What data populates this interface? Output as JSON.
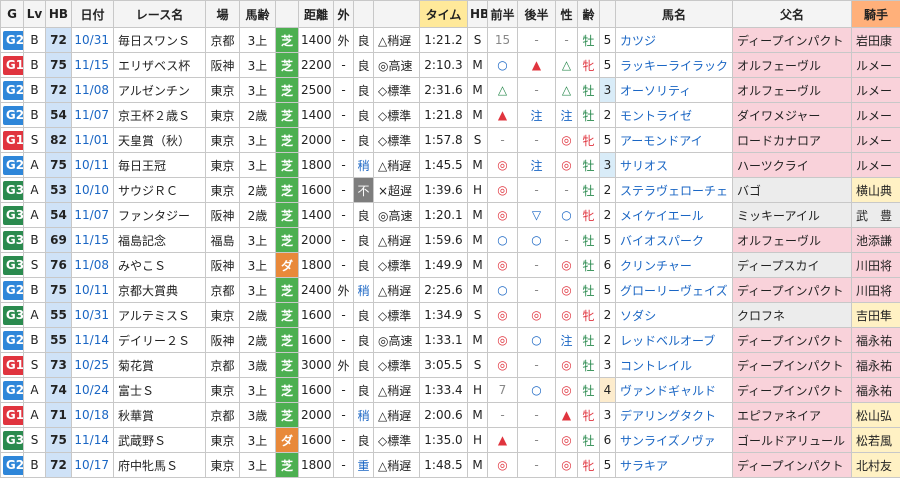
{
  "headers": {
    "g": "G",
    "lv": "Lv",
    "hb": "HB",
    "date": "日付",
    "race": "レース名",
    "venue": "場",
    "age": "馬齢",
    "surf": "芝",
    "dist": "距離",
    "rail": "外",
    "cond": "",
    "pace": "",
    "time": "タイム",
    "hbcls": "HB",
    "first": "前半",
    "second": "後半",
    "sex": "性",
    "horse_age": "齢",
    "horse": "馬名",
    "sire": "父名",
    "jockey": "騎手",
    "dist_label": "距離",
    "hb2": "HB",
    "first_label": "前半",
    "second_label": "後半",
    "sex_label": "性",
    "age_label": "齢",
    "horse_label": "馬名",
    "sire_label": "父名",
    "jockey_label": "騎手",
    "race_label": "レース名",
    "venue_label": "場",
    "age_race_label": "馬齢",
    "date_label": "日付",
    "time_label": "タイム",
    "outer_label": "外"
  },
  "rows": [
    {
      "g": "G2",
      "lv": "B",
      "hb": "72",
      "date": "10/31",
      "race": "毎日スワンＳ",
      "venue": "京都",
      "age": "3上",
      "surf": "芝",
      "dist": "1400",
      "rail": "外",
      "cond": "良",
      "pace": "△稍遅",
      "time": "1:21.2",
      "cls": "S",
      "first": "15",
      "second": "-",
      "f1": "-",
      "sex": "牡",
      "hage": "5",
      "horse": "カツジ",
      "sire": "ディープインパクト",
      "jockey": "岩田康"
    },
    {
      "g": "G1",
      "lv": "B",
      "hb": "75",
      "date": "11/15",
      "race": "エリザベス杯",
      "venue": "阪神",
      "age": "3上",
      "surf": "芝",
      "dist": "2200",
      "rail": "-",
      "cond": "良",
      "pace": "◎高速",
      "time": "2:10.3",
      "cls": "M",
      "first": "○",
      "second": "▲",
      "f1": "△",
      "sex": "牝",
      "hage": "5",
      "horse": "ラッキーライラック",
      "sire": "オルフェーヴル",
      "jockey": "ルメー"
    },
    {
      "g": "G2",
      "lv": "B",
      "hb": "72",
      "date": "11/08",
      "race": "アルゼンチン",
      "venue": "東京",
      "age": "3上",
      "surf": "芝",
      "dist": "2500",
      "rail": "-",
      "cond": "良",
      "pace": "◇標準",
      "time": "2:31.6",
      "cls": "M",
      "first": "△",
      "second": "-",
      "f1": "△",
      "sex": "牡",
      "hage": "3",
      "horse": "オーソリティ",
      "sire": "オルフェーヴル",
      "jockey": "ルメー"
    },
    {
      "g": "G2",
      "lv": "B",
      "hb": "54",
      "date": "11/07",
      "race": "京王杯２歳Ｓ",
      "venue": "東京",
      "age": "2歳",
      "surf": "芝",
      "dist": "1400",
      "rail": "-",
      "cond": "良",
      "pace": "◇標準",
      "time": "1:21.8",
      "cls": "M",
      "first": "▲",
      "second": "注",
      "f1": "注",
      "sex": "牡",
      "hage": "2",
      "horse": "モントライゼ",
      "sire": "ダイワメジャー",
      "jockey": "ルメー"
    },
    {
      "g": "G1",
      "lv": "S",
      "hb": "82",
      "date": "11/01",
      "race": "天皇賞（秋）",
      "venue": "東京",
      "age": "3上",
      "surf": "芝",
      "dist": "2000",
      "rail": "-",
      "cond": "良",
      "pace": "◇標準",
      "time": "1:57.8",
      "cls": "S",
      "first": "-",
      "second": "-",
      "f1": "◎",
      "sex": "牝",
      "hage": "5",
      "horse": "アーモンドアイ",
      "sire": "ロードカナロア",
      "jockey": "ルメー"
    },
    {
      "g": "G2",
      "lv": "A",
      "hb": "75",
      "date": "10/11",
      "race": "毎日王冠",
      "venue": "東京",
      "age": "3上",
      "surf": "芝",
      "dist": "1800",
      "rail": "-",
      "cond": "稍",
      "pace": "△稍遅",
      "time": "1:45.5",
      "cls": "M",
      "first": "◎",
      "second": "注",
      "f1": "◎",
      "sex": "牡",
      "hage": "3",
      "horse": "サリオス",
      "sire": "ハーツクライ",
      "jockey": "ルメー"
    },
    {
      "g": "G3",
      "lv": "A",
      "hb": "53",
      "date": "10/10",
      "race": "サウジＲＣ",
      "venue": "東京",
      "age": "2歳",
      "surf": "芝",
      "dist": "1600",
      "rail": "-",
      "cond": "不",
      "pace": "×超遅",
      "time": "1:39.6",
      "cls": "H",
      "first": "◎",
      "second": "-",
      "f1": "-",
      "sex": "牡",
      "hage": "2",
      "horse": "ステラヴェローチェ",
      "sire": "バゴ",
      "jockey": "横山典"
    },
    {
      "g": "G3",
      "lv": "A",
      "hb": "54",
      "date": "11/07",
      "race": "ファンタジー",
      "venue": "阪神",
      "age": "2歳",
      "surf": "芝",
      "dist": "1400",
      "rail": "-",
      "cond": "良",
      "pace": "◎高速",
      "time": "1:20.1",
      "cls": "M",
      "first": "◎",
      "second": "▽",
      "f1": "○",
      "sex": "牝",
      "hage": "2",
      "horse": "メイケイエール",
      "sire": "ミッキーアイル",
      "jockey": "武　豊"
    },
    {
      "g": "G3",
      "lv": "B",
      "hb": "69",
      "date": "11/15",
      "race": "福島記念",
      "venue": "福島",
      "age": "3上",
      "surf": "芝",
      "dist": "2000",
      "rail": "-",
      "cond": "良",
      "pace": "△稍遅",
      "time": "1:59.6",
      "cls": "M",
      "first": "○",
      "second": "○",
      "f1": "-",
      "sex": "牡",
      "hage": "5",
      "horse": "バイオスパーク",
      "sire": "オルフェーヴル",
      "jockey": "池添謙"
    },
    {
      "g": "G3",
      "lv": "S",
      "hb": "76",
      "date": "11/08",
      "race": "みやこＳ",
      "venue": "阪神",
      "age": "3上",
      "surf": "ダ",
      "dist": "1800",
      "rail": "-",
      "cond": "良",
      "pace": "◇標準",
      "time": "1:49.9",
      "cls": "M",
      "first": "◎",
      "second": "-",
      "f1": "◎",
      "sex": "牡",
      "hage": "6",
      "horse": "クリンチャー",
      "sire": "ディープスカイ",
      "jockey": "川田将"
    },
    {
      "g": "G2",
      "lv": "B",
      "hb": "75",
      "date": "10/11",
      "race": "京都大賞典",
      "venue": "京都",
      "age": "3上",
      "surf": "芝",
      "dist": "2400",
      "rail": "外",
      "cond": "稍",
      "pace": "△稍遅",
      "time": "2:25.6",
      "cls": "M",
      "first": "○",
      "second": "-",
      "f1": "◎",
      "sex": "牡",
      "hage": "5",
      "horse": "グローリーヴェイズ",
      "sire": "ディープインパクト",
      "jockey": "川田将"
    },
    {
      "g": "G3",
      "lv": "A",
      "hb": "55",
      "date": "10/31",
      "race": "アルテミスＳ",
      "venue": "東京",
      "age": "2歳",
      "surf": "芝",
      "dist": "1600",
      "rail": "-",
      "cond": "良",
      "pace": "◇標準",
      "time": "1:34.9",
      "cls": "S",
      "first": "◎",
      "second": "◎",
      "f1": "◎",
      "sex": "牝",
      "hage": "2",
      "horse": "ソダシ",
      "sire": "クロフネ",
      "jockey": "吉田隼"
    },
    {
      "g": "G2",
      "lv": "B",
      "hb": "55",
      "date": "11/14",
      "race": "デイリー２Ｓ",
      "venue": "阪神",
      "age": "2歳",
      "surf": "芝",
      "dist": "1600",
      "rail": "-",
      "cond": "良",
      "pace": "◎高速",
      "time": "1:33.1",
      "cls": "M",
      "first": "◎",
      "second": "○",
      "f1": "注",
      "sex": "牡",
      "hage": "2",
      "horse": "レッドベルオーブ",
      "sire": "ディープインパクト",
      "jockey": "福永祐"
    },
    {
      "g": "G1",
      "lv": "S",
      "hb": "73",
      "date": "10/25",
      "race": "菊花賞",
      "venue": "京都",
      "age": "3歳",
      "surf": "芝",
      "dist": "3000",
      "rail": "外",
      "cond": "良",
      "pace": "◇標準",
      "time": "3:05.5",
      "cls": "S",
      "first": "◎",
      "second": "-",
      "f1": "◎",
      "sex": "牡",
      "hage": "3",
      "horse": "コントレイル",
      "sire": "ディープインパクト",
      "jockey": "福永祐"
    },
    {
      "g": "G2",
      "lv": "A",
      "hb": "74",
      "date": "10/24",
      "race": "富士Ｓ",
      "venue": "東京",
      "age": "3上",
      "surf": "芝",
      "dist": "1600",
      "rail": "-",
      "cond": "良",
      "pace": "△稍遅",
      "time": "1:33.4",
      "cls": "H",
      "first": "7",
      "second": "○",
      "f1": "◎",
      "sex": "牡",
      "hage": "4",
      "horse": "ヴァンドギャルド",
      "sire": "ディープインパクト",
      "jockey": "福永祐"
    },
    {
      "g": "G1",
      "lv": "A",
      "hb": "71",
      "date": "10/18",
      "race": "秋華賞",
      "venue": "京都",
      "age": "3歳",
      "surf": "芝",
      "dist": "2000",
      "rail": "-",
      "cond": "稍",
      "pace": "△稍遅",
      "time": "2:00.6",
      "cls": "M",
      "first": "-",
      "second": "-",
      "f1": "▲",
      "sex": "牝",
      "hage": "3",
      "horse": "デアリングタクト",
      "sire": "エピファネイア",
      "jockey": "松山弘"
    },
    {
      "g": "G3",
      "lv": "S",
      "hb": "75",
      "date": "11/14",
      "race": "武蔵野Ｓ",
      "venue": "東京",
      "age": "3上",
      "surf": "ダ",
      "dist": "1600",
      "rail": "-",
      "cond": "良",
      "pace": "◇標準",
      "time": "1:35.0",
      "cls": "H",
      "first": "▲",
      "second": "-",
      "f1": "◎",
      "sex": "牡",
      "hage": "6",
      "horse": "サンライズノヴァ",
      "sire": "ゴールドアリュール",
      "jockey": "松若風"
    },
    {
      "g": "G2",
      "lv": "B",
      "hb": "72",
      "date": "10/17",
      "race": "府中牝馬Ｓ",
      "venue": "東京",
      "age": "3上",
      "surf": "芝",
      "dist": "1800",
      "rail": "-",
      "cond": "重",
      "pace": "△稍遅",
      "time": "1:48.5",
      "cls": "M",
      "first": "◎",
      "second": "-",
      "f1": "◎",
      "sex": "牝",
      "hage": "5",
      "horse": "サラキア",
      "sire": "ディープインパクト",
      "jockey": "北村友"
    }
  ],
  "colors": {
    "g1": "#e0343e",
    "g2": "#2e86d9",
    "g3": "#2a8a4e",
    "turf": "#4caf50",
    "dirt": "#e8893a",
    "hb_bg": "#cfe2f7",
    "jockey_header": "#ffb07a",
    "time_header": "#ffe99a"
  }
}
